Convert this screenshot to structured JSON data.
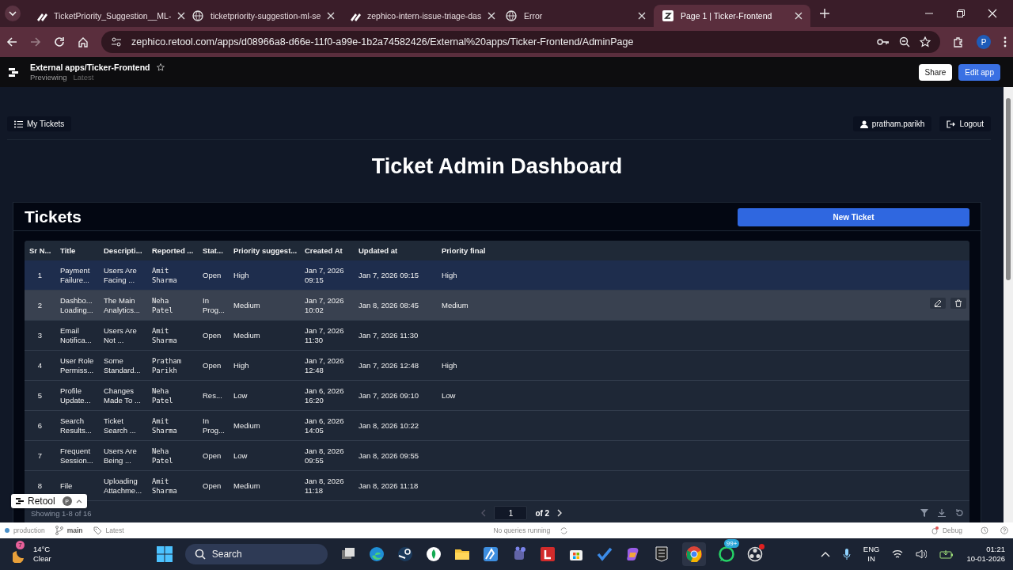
{
  "browser": {
    "tabs": [
      {
        "title": "TicketPriority_Suggestion__ML-",
        "selected": false
      },
      {
        "title": "ticketpriority-suggestion-ml-se",
        "selected": false
      },
      {
        "title": "zephico-intern-issue-triage-das",
        "selected": false
      },
      {
        "title": "Error",
        "selected": false
      },
      {
        "title": "Page 1 | Ticker-Frontend",
        "selected": true
      }
    ],
    "url": "zephico.retool.com/apps/d08966a8-d66e-11f0-a99e-1b2a74582426/External%20apps/Ticker-Frontend/AdminPage",
    "profile": "P"
  },
  "retool_header": {
    "app_path": "External apps/Ticker-Frontend",
    "mode": "Previewing",
    "version": "Latest",
    "share": "Share",
    "edit": "Edit app"
  },
  "app": {
    "nav_button": "My Tickets",
    "user": "pratham.parikh",
    "logout": "Logout",
    "heading": "Ticket Admin Dashboard",
    "card": {
      "title": "Tickets",
      "new_button": "New Ticket",
      "table": {
        "columns": [
          "Sr N...",
          "Title",
          "Descripti...",
          "Reported ...",
          "Stat...",
          "Priority suggest...",
          "Created At",
          "Updated at",
          "Priority final"
        ],
        "rows": [
          {
            "cells": [
              "1",
              "Payment\nFailure...",
              "Users Are\nFacing ...",
              "Amit\nSharma",
              "Open",
              "High",
              "Jan 7, 2026\n09:15",
              "Jan 7, 2026 09:15",
              "High"
            ],
            "selected": true,
            "hovered": false
          },
          {
            "cells": [
              "2",
              "Dashbo...\nLoading...",
              "The Main\nAnalytics...",
              "Neha\nPatel",
              "In\nProg...",
              "Medium",
              "Jan 7, 2026\n10:02",
              "Jan 8, 2026 08:45",
              "Medium"
            ],
            "selected": false,
            "hovered": true
          },
          {
            "cells": [
              "3",
              "Email\nNotifica...",
              "Users Are\nNot ...",
              "Amit\nSharma",
              "Open",
              "Medium",
              "Jan 7, 2026\n11:30",
              "Jan 7, 2026 11:30"
            ],
            "selected": false,
            "hovered": false
          },
          {
            "cells": [
              "4",
              "User Role\nPermiss...",
              "Some\nStandard...",
              "Pratham\nParikh",
              "Open",
              "High",
              "Jan 7, 2026\n12:48",
              "Jan 7, 2026 12:48",
              "High"
            ],
            "selected": false,
            "hovered": false
          },
          {
            "cells": [
              "5",
              "Profile\nUpdate...",
              "Changes\nMade To ...",
              "Neha\nPatel",
              "Res...",
              "Low",
              "Jan 6, 2026\n16:20",
              "Jan 7, 2026 09:10",
              "Low"
            ],
            "selected": false,
            "hovered": false
          },
          {
            "cells": [
              "6",
              "Search\nResults...",
              "Ticket\nSearch ...",
              "Amit\nSharma",
              "In\nProg...",
              "Medium",
              "Jan 6, 2026\n14:05",
              "Jan 8, 2026 10:22"
            ],
            "selected": false,
            "hovered": false
          },
          {
            "cells": [
              "7",
              "Frequent\nSession...",
              "Users Are\nBeing ...",
              "Neha\nPatel",
              "Open",
              "Low",
              "Jan 8, 2026\n09:55",
              "Jan 8, 2026 09:55"
            ],
            "selected": false,
            "hovered": false
          },
          {
            "cells": [
              "8",
              "File",
              "Uploading\nAttachme...",
              "Amit\nSharma",
              "Open",
              "Medium",
              "Jan 8, 2026\n11:18",
              "Jan 8, 2026 11:18"
            ],
            "selected": false,
            "hovered": false
          }
        ],
        "footer": "Showing 1-8 of 16",
        "page": "1",
        "page_total": "of 2"
      }
    }
  },
  "retool_badge": {
    "label": "Retool",
    "avatar": "P"
  },
  "status_bar": {
    "environment": "production",
    "branch": "main",
    "tag": "Latest",
    "queries": "No queries running",
    "debug": "Debug"
  },
  "taskbar": {
    "temperature": "14°C",
    "condition": "Clear",
    "weather_badge": "7",
    "search": "Search",
    "chat_badge": "99+",
    "language": "ENG",
    "region": "IN",
    "time": "01:21",
    "date": "10-01-2026"
  }
}
